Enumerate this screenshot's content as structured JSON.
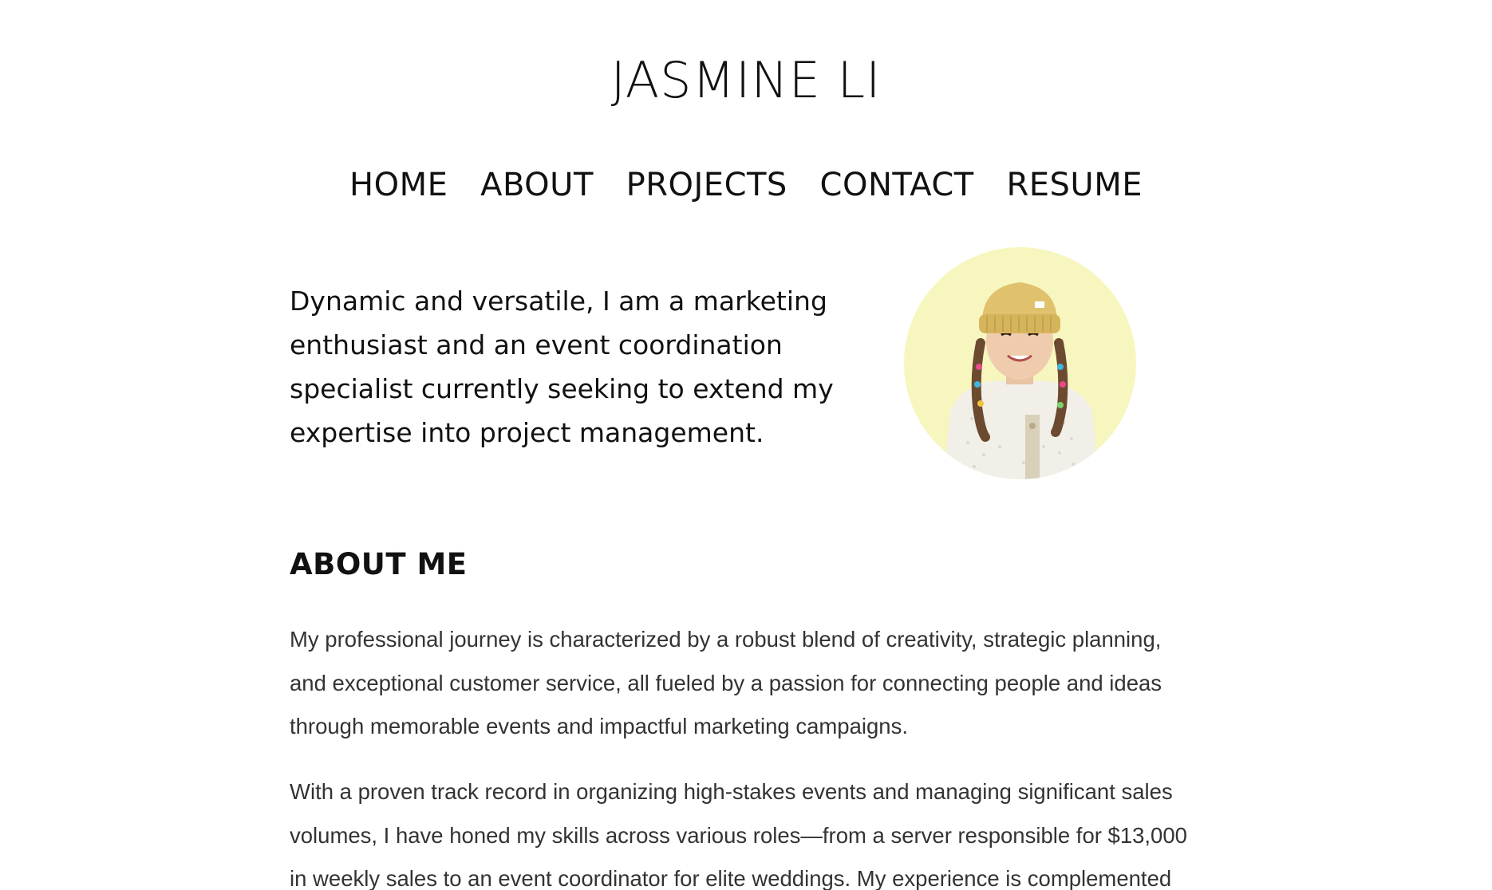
{
  "site": {
    "title": "JASMINE LI"
  },
  "nav": {
    "items": [
      "HOME",
      "ABOUT",
      "PROJECTS",
      "CONTACT",
      "RESUME"
    ]
  },
  "intro": {
    "text": "Dynamic and versatile, I am a marketing enthusiast and an event coordination specialist currently seeking to extend my expertise into project management."
  },
  "portrait": {
    "icon": "portrait-photo",
    "background_color": "#f8f6bf"
  },
  "about": {
    "heading": "ABOUT ME",
    "paragraphs": [
      "My professional journey is characterized by a robust blend of creativity, strategic planning, and exceptional customer service, all fueled by a passion for connecting people and ideas through memorable events and impactful marketing campaigns.",
      "With a proven track record in organizing high-stakes events and managing significant sales volumes, I have honed my skills across various roles—from a server responsible for $13,000 in weekly sales to an event coordinator for elite weddings. My experience is complemented"
    ]
  }
}
